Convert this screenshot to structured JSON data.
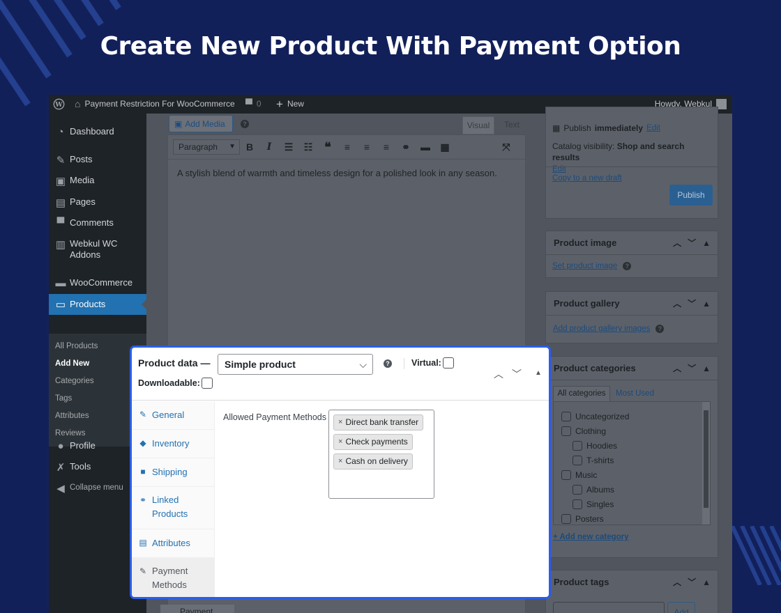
{
  "hero": {
    "title": "Create New Product With Payment Option"
  },
  "adminbar": {
    "site_name": "Payment Restriction For WooCommerce",
    "comments_count": "0",
    "new_label": "New",
    "greeting": "Howdy, Webkul"
  },
  "sidebar": {
    "items": [
      {
        "label": "Dashboard",
        "icon": "dashboard-icon"
      },
      {
        "label": "Posts",
        "icon": "pin-icon"
      },
      {
        "label": "Media",
        "icon": "media-icon"
      },
      {
        "label": "Pages",
        "icon": "pages-icon"
      },
      {
        "label": "Comments",
        "icon": "comments-icon"
      },
      {
        "label": "Webkul WC Addons",
        "icon": "webkul-icon"
      },
      {
        "label": "WooCommerce",
        "icon": "woocommerce-icon"
      },
      {
        "label": "Products",
        "icon": "products-icon"
      },
      {
        "label": "Profile",
        "icon": "user-icon"
      },
      {
        "label": "Tools",
        "icon": "wrench-icon"
      },
      {
        "label": "Collapse menu",
        "icon": "collapse-icon"
      }
    ],
    "submenu": [
      "All Products",
      "Add New",
      "Categories",
      "Tags",
      "Attributes",
      "Reviews"
    ]
  },
  "editor": {
    "add_media": "Add Media",
    "tab_visual": "Visual",
    "tab_text": "Text",
    "format_select": "Paragraph",
    "content": "A stylish blend of warmth and timeless design for a polished look in any season."
  },
  "publish_box": {
    "publish_prefix": "Publish",
    "publish_when": "immediately",
    "edit": "Edit",
    "visibility_label": "Catalog visibility:",
    "visibility_value": "Shop and search results",
    "copy_draft": "Copy to a new draft",
    "publish_button": "Publish"
  },
  "product_image": {
    "title": "Product image",
    "link": "Set product image"
  },
  "product_gallery": {
    "title": "Product gallery",
    "link": "Add product gallery images"
  },
  "product_categories": {
    "title": "Product categories",
    "tabs": [
      "All categories",
      "Most Used"
    ],
    "items": [
      {
        "label": "Uncategorized",
        "level": 0
      },
      {
        "label": "Clothing",
        "level": 0
      },
      {
        "label": "Hoodies",
        "level": 1
      },
      {
        "label": "T-shirts",
        "level": 1
      },
      {
        "label": "Music",
        "level": 0
      },
      {
        "label": "Albums",
        "level": 1
      },
      {
        "label": "Singles",
        "level": 1
      },
      {
        "label": "Posters",
        "level": 0
      }
    ],
    "add_new": "+ Add new category"
  },
  "product_tags": {
    "title": "Product tags",
    "add_button": "Add"
  },
  "product_data": {
    "title": "Product data —",
    "type_select": "Simple product",
    "virtual_label": "Virtual:",
    "downloadable_label": "Downloadable:",
    "tabs": [
      "General",
      "Inventory",
      "Shipping",
      "Linked Products",
      "Attributes",
      "Payment Methods"
    ],
    "field_label": "Allowed Payment Methods",
    "selected_methods": [
      "Direct bank transfer",
      "Check payments",
      "Cash on delivery"
    ],
    "bottom_peek": "Payment"
  },
  "colors": {
    "background": "#12205a",
    "accent": "#2b5ee8",
    "wp_blue": "#2271b1"
  }
}
